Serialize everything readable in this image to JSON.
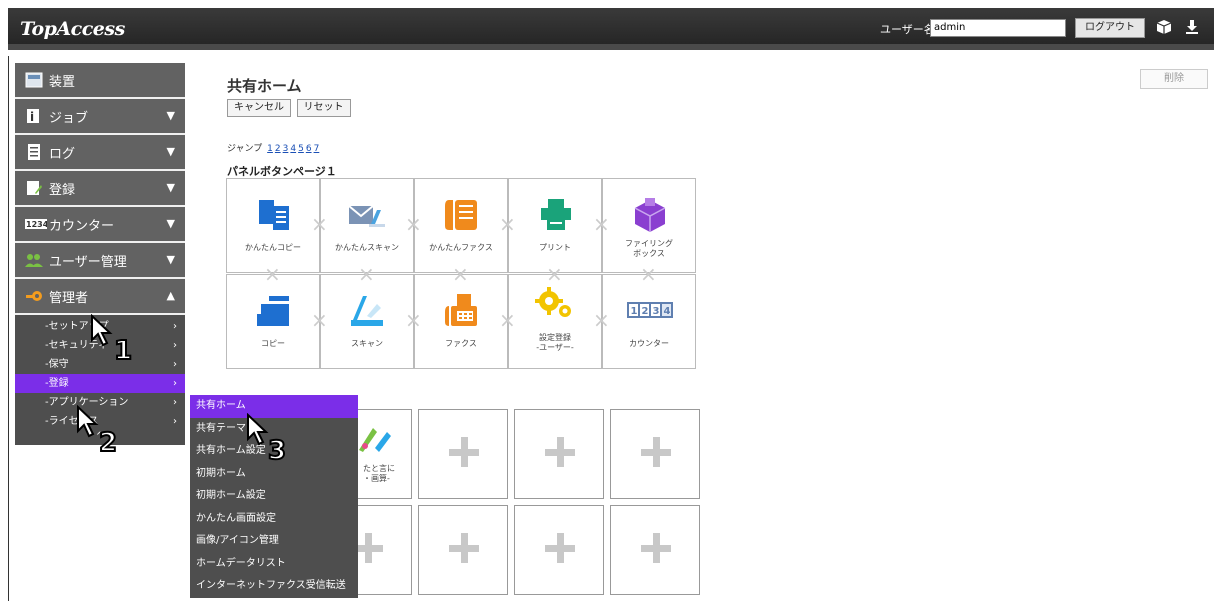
{
  "header": {
    "logo": "TopAccess",
    "user_label": "ユーザー名",
    "user_value": "admin",
    "logout_label": "ログアウト",
    "icons": [
      "box-icon",
      "download-icon"
    ]
  },
  "sidebar": {
    "items": [
      {
        "label": "装置",
        "icon": "device-icon",
        "expanded": null
      },
      {
        "label": "ジョブ",
        "icon": "job-icon",
        "expanded": false
      },
      {
        "label": "ログ",
        "icon": "log-icon",
        "expanded": false
      },
      {
        "label": "登録",
        "icon": "register-icon",
        "expanded": false
      },
      {
        "label": "カウンター",
        "icon": "counter-icon",
        "expanded": false
      },
      {
        "label": "ユーザー管理",
        "icon": "users-icon",
        "expanded": false
      },
      {
        "label": "管理者",
        "icon": "key-icon",
        "expanded": true
      }
    ],
    "sub_items": [
      {
        "label": "-セットアップ",
        "active": false
      },
      {
        "label": "-セキュリティ",
        "active": false
      },
      {
        "label": "-保守",
        "active": false
      },
      {
        "label": "-登録",
        "active": true
      },
      {
        "label": "-アプリケーション",
        "active": false
      },
      {
        "label": "-ライセンス",
        "active": false
      }
    ],
    "collapse_glyph": "^"
  },
  "main": {
    "title": "共有ホーム",
    "cancel_label": "キャンセル",
    "reset_label": "リセット",
    "delete_label": "削除",
    "jump_label": "ジャンプ",
    "jump_pages": [
      "1",
      "2",
      "3",
      "4",
      "5",
      "6",
      "7"
    ],
    "page_label": "パネルボタンページ１",
    "tiles_row1": [
      {
        "label": "かんたんコピー",
        "icon": "easy-copy-icon"
      },
      {
        "label": "かんたんスキャン",
        "icon": "easy-scan-icon"
      },
      {
        "label": "かんたんファクス",
        "icon": "easy-fax-icon"
      },
      {
        "label": "プリント",
        "icon": "print-icon"
      },
      {
        "label": "ファイリング\nボックス",
        "icon": "filing-box-icon"
      }
    ],
    "tiles_row2": [
      {
        "label": "コピー",
        "icon": "copy-icon"
      },
      {
        "label": "スキャン",
        "icon": "scan-icon"
      },
      {
        "label": "ファクス",
        "icon": "fax-icon"
      },
      {
        "label": "設定登録\n-ユーザー-",
        "icon": "settings-gear-icon"
      },
      {
        "label": "カウンター",
        "icon": "counter-display-icon"
      }
    ],
    "partial_tile_label": "たと言に\n・画算-"
  },
  "flyout": {
    "items": [
      {
        "label": "共有ホーム",
        "active": true
      },
      {
        "label": "共有テーマ",
        "active": false
      },
      {
        "label": "共有ホーム設定",
        "active": false
      },
      {
        "label": "初期ホーム",
        "active": false
      },
      {
        "label": "初期ホーム設定",
        "active": false
      },
      {
        "label": "かんたん画面設定",
        "active": false
      },
      {
        "label": "画像/アイコン管理",
        "active": false
      },
      {
        "label": "ホームデータリスト",
        "active": false
      },
      {
        "label": "インターネットファクス受信転送",
        "active": false
      }
    ]
  },
  "cursors": [
    "1",
    "2",
    "3"
  ],
  "colors": {
    "accent": "#7b2ee8",
    "nav_bg": "#626262",
    "sub_bg": "#4e4e4e",
    "header_bg": "#2e2e2e"
  }
}
